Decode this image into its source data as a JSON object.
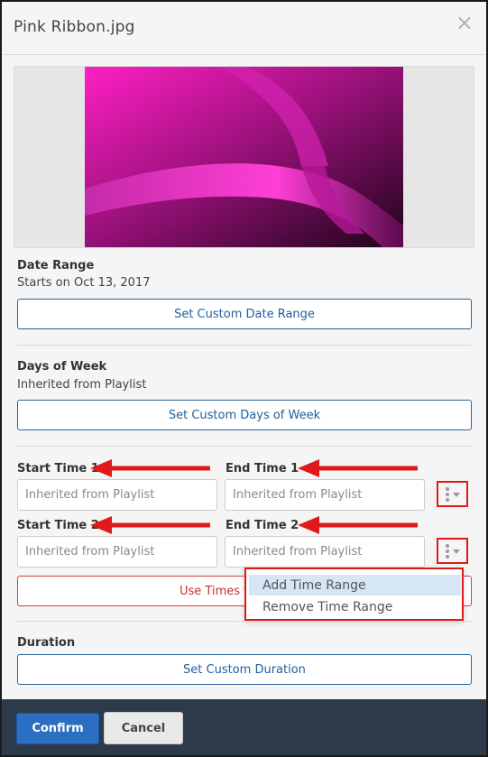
{
  "dialog": {
    "title": "Pink Ribbon.jpg",
    "close_glyph": "×"
  },
  "preview": {
    "image": "pink-ribbon-thumbnail",
    "colors": {
      "light": "#ff1fc4",
      "mid": "#c2169a",
      "dark": "#2a0624"
    }
  },
  "date_range": {
    "label": "Date Range",
    "value": "Starts on Oct 13, 2017",
    "button_label": "Set Custom Date Range"
  },
  "days_of_week": {
    "label": "Days of Week",
    "value": "Inherited from Playlist",
    "button_label": "Set Custom Days of Week"
  },
  "times": {
    "rows": [
      {
        "start_label": "Start Time 1",
        "end_label": "End Time 1",
        "start_placeholder": "Inherited from Playlist",
        "end_placeholder": "Inherited from Playlist"
      },
      {
        "start_label": "Start Time 2",
        "end_label": "End Time 2",
        "start_placeholder": "Inherited from Playlist",
        "end_placeholder": "Inherited from Playlist"
      }
    ],
    "use_times_button_label": "Use Times f",
    "menu": {
      "items": [
        "Add Time Range",
        "Remove Time Range"
      ]
    }
  },
  "duration": {
    "label": "Duration",
    "button_label": "Set Custom Duration"
  },
  "footer": {
    "confirm_label": "Confirm",
    "cancel_label": "Cancel"
  },
  "colors": {
    "annotation_red": "#e01a1a",
    "primary_blue": "#2a6fc1",
    "footer_bg": "#2c3a4a"
  }
}
